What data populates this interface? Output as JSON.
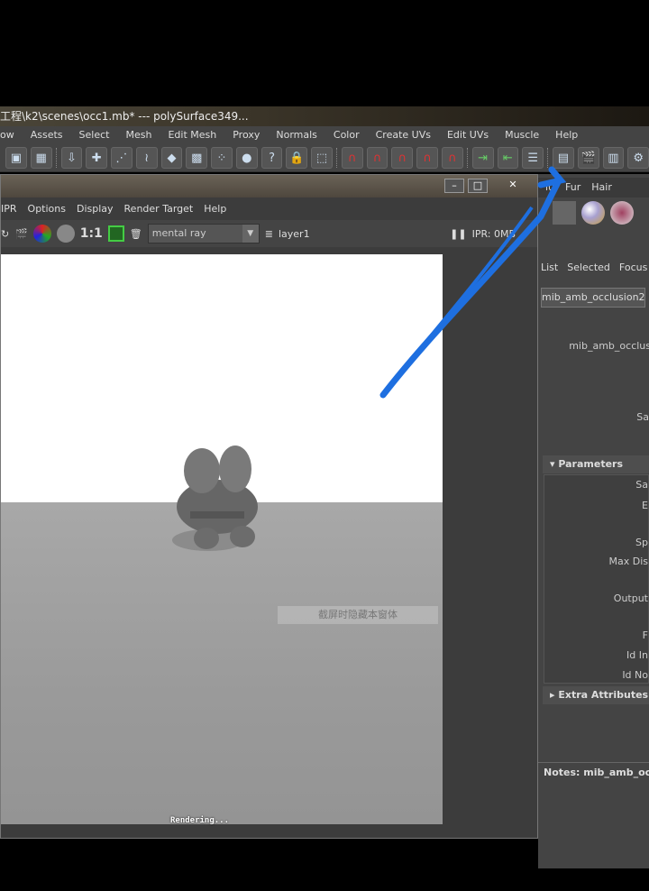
{
  "title": "工程\\k2\\scenes\\occ1.mb*  ---  polySurface349...",
  "menu": [
    "ow",
    "Assets",
    "Select",
    "Mesh",
    "Edit Mesh",
    "Proxy",
    "Normals",
    "Color",
    "Create UVs",
    "Edit UVs",
    "Muscle",
    "Help"
  ],
  "render_view": {
    "menu": [
      "IPR",
      "Options",
      "Display",
      "Render Target",
      "Help"
    ],
    "ratio": "1:1",
    "renderer": "mental ray",
    "layer": "layer1",
    "ipr": "IPR: 0MB",
    "overlay_text": "截屏时隐藏本窗体",
    "status": "Rendering..."
  },
  "shelf_tabs": [
    "lu",
    "Fur",
    "Hair"
  ],
  "attr_editor": {
    "menu": [
      "List",
      "Selected",
      "Focus"
    ],
    "tab": "mib_amb_occlusion2",
    "node_label": "mib_amb_occlus",
    "sample_label": "Sa",
    "section": "Parameters",
    "params": [
      "Sa",
      "E",
      "Sp",
      "Max Dis",
      "Output",
      "F",
      "Id In",
      "Id No"
    ],
    "extra": "Extra Attributes",
    "notes": "Notes: mib_amb_occ"
  },
  "colors": {
    "annotation_arrow": "#1e6fe0"
  }
}
